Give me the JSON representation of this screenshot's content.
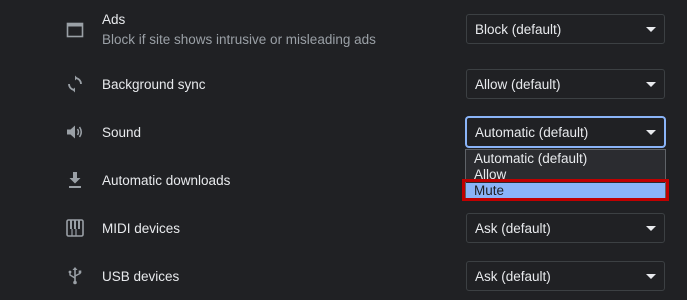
{
  "settings": [
    {
      "id": "ads",
      "label": "Ads",
      "sublabel": "Block if site shows intrusive or misleading ads",
      "value": "Block (default)",
      "icon": "ads-window-icon"
    },
    {
      "id": "background-sync",
      "label": "Background sync",
      "value": "Allow (default)",
      "icon": "sync-icon"
    },
    {
      "id": "sound",
      "label": "Sound",
      "value": "Automatic (default)",
      "icon": "speaker-icon"
    },
    {
      "id": "automatic-downloads",
      "label": "Automatic downloads",
      "icon": "download-icon"
    },
    {
      "id": "midi-devices",
      "label": "MIDI devices",
      "value": "Ask (default)",
      "icon": "piano-keys-icon"
    },
    {
      "id": "usb-devices",
      "label": "USB devices",
      "value": "Ask (default)",
      "icon": "usb-icon"
    }
  ],
  "sound_dropdown": {
    "options": [
      "Automatic (default)",
      "Allow",
      "Mute"
    ],
    "highlighted": "Mute"
  },
  "colors": {
    "background": "#202124",
    "text": "#e8eaed",
    "secondary_text": "#9aa0a6",
    "focus": "#8ab4f8",
    "annotation": "#c00000"
  }
}
